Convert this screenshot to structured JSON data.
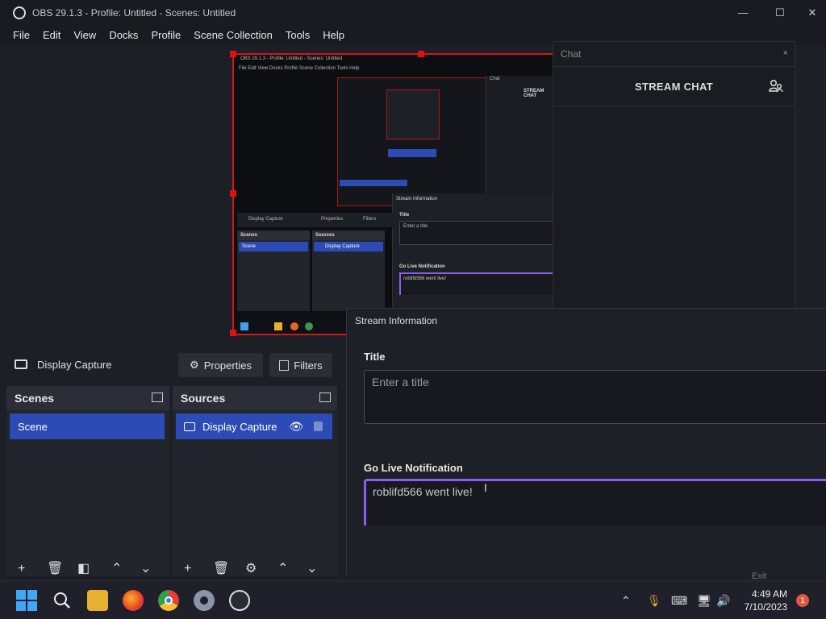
{
  "window": {
    "title": "OBS 29.1.3 - Profile: Untitled - Scenes: Untitled",
    "controls": [
      "minimize-icon",
      "maximize-icon",
      "close-icon"
    ]
  },
  "menu": [
    "File",
    "Edit",
    "View",
    "Docks",
    "Profile",
    "Scene Collection",
    "Tools",
    "Help"
  ],
  "preview": {
    "mini": {
      "title": "OBS 29.1.3 - Profile: Untitled - Scenes: Untitled",
      "menu": "File  Edit  View  Docks  Profile  Scene Collection  Tools  Help",
      "chat_label": "Chat",
      "stream_chat": "STREAM CHAT",
      "stream_info": "Stream Information",
      "title_label": "Title",
      "title_placeholder": "Enter a title",
      "go_live_label": "Go Live Notification",
      "go_live_value": "roblifd566 went live!",
      "source_name": "Display Capture",
      "properties": "Properties",
      "filters": "Filters",
      "scenes": "Scenes",
      "sources": "Sources",
      "scene_item": "Scene",
      "source_item": "Display Capture"
    }
  },
  "chat": {
    "header": "Chat",
    "close": "×",
    "banner": "STREAM CHAT",
    "icon": "users-icon"
  },
  "source_toolbar": {
    "source_name": "Display Capture",
    "properties_label": "Properties",
    "filters_label": "Filters"
  },
  "scenes": {
    "title": "Scenes",
    "items": [
      "Scene"
    ]
  },
  "sources": {
    "title": "Sources",
    "items": [
      "Display Capture"
    ]
  },
  "stream_info": {
    "header": "Stream Information",
    "title_label": "Title",
    "title_placeholder": "Enter a title",
    "go_live_label": "Go Live Notification",
    "go_live_value": "roblifd566 went live!",
    "exit_label": "Exit"
  },
  "taskbar": {
    "time": "4:49 AM",
    "date": "7/10/2023",
    "notification_count": "1",
    "apps": [
      "start-icon",
      "search-icon",
      "file-explorer-icon",
      "firefox-icon",
      "chrome-icon",
      "settings-icon",
      "obs-icon"
    ]
  },
  "colors": {
    "accent_blue": "#2d4bb5",
    "selection_red": "#d01818",
    "focus_purple": "#8a5cf0"
  }
}
